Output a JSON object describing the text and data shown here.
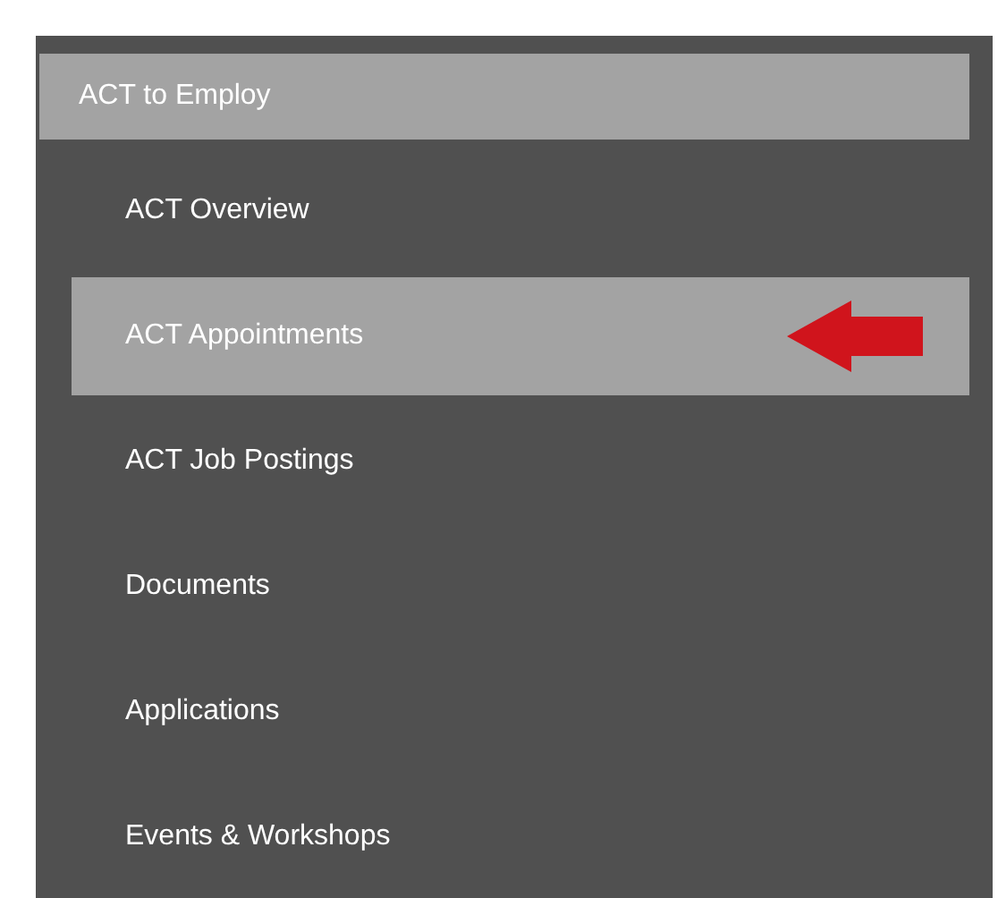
{
  "menu": {
    "header": "ACT to Employ",
    "items": [
      {
        "label": "ACT Overview",
        "selected": false
      },
      {
        "label": "ACT Appointments",
        "selected": true
      },
      {
        "label": "ACT Job Postings",
        "selected": false
      },
      {
        "label": "Documents",
        "selected": false
      },
      {
        "label": "Applications",
        "selected": false
      },
      {
        "label": "Events & Workshops",
        "selected": false
      }
    ]
  }
}
